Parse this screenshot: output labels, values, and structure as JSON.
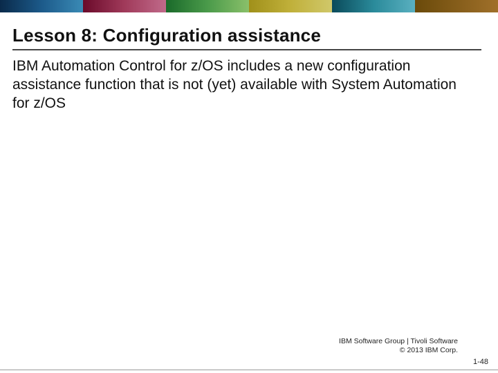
{
  "slide": {
    "title": "Lesson 8: Configuration assistance",
    "body": "IBM Automation Control for z/OS includes a new configuration assistance function that is not (yet) available with System Automation for z/OS"
  },
  "footer": {
    "org": "IBM Software Group | Tivoli Software",
    "copyright": "© 2013 IBM Corp.",
    "page": "1-48"
  }
}
